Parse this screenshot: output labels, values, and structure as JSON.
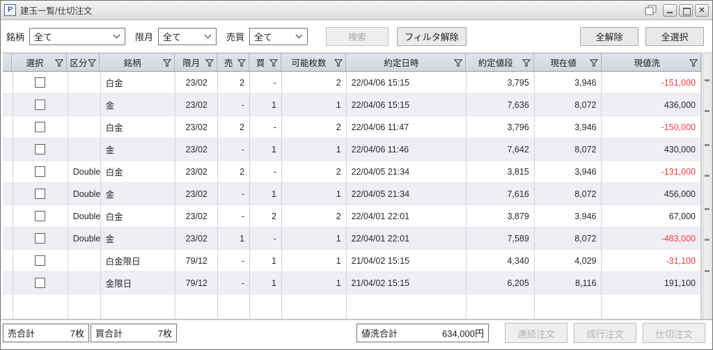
{
  "window": {
    "title": "建玉一覧/仕切注文",
    "icon_letter": "P"
  },
  "filters": {
    "symbol_label": "銘柄",
    "symbol_value": "全て",
    "month_label": "限月",
    "month_value": "全て",
    "side_label": "売買",
    "side_value": "全て",
    "search_button": "検索",
    "clear_filter_button": "フィルタ解除",
    "deselect_all_button": "全解除",
    "select_all_button": "全選択"
  },
  "table": {
    "columns": [
      "選択",
      "区分",
      "銘柄",
      "限月",
      "売",
      "買",
      "可能枚数",
      "約定日時",
      "約定値段",
      "現在値",
      "現値洗"
    ],
    "rows": [
      {
        "kubun": "",
        "name": "白金",
        "month": "23/02",
        "sell": "2",
        "buy": "-",
        "qty": "2",
        "time": "22/04/06 15:15",
        "price": "3,795",
        "now": "3,946",
        "pnl": "-151,000"
      },
      {
        "kubun": "",
        "name": "金",
        "month": "23/02",
        "sell": "-",
        "buy": "1",
        "qty": "1",
        "time": "22/04/06 15:15",
        "price": "7,636",
        "now": "8,072",
        "pnl": "436,000"
      },
      {
        "kubun": "",
        "name": "白金",
        "month": "23/02",
        "sell": "2",
        "buy": "-",
        "qty": "2",
        "time": "22/04/06 11:47",
        "price": "3,796",
        "now": "3,946",
        "pnl": "-150,000"
      },
      {
        "kubun": "",
        "name": "金",
        "month": "23/02",
        "sell": "-",
        "buy": "1",
        "qty": "1",
        "time": "22/04/06 11:46",
        "price": "7,642",
        "now": "8,072",
        "pnl": "430,000"
      },
      {
        "kubun": "Double",
        "name": "白金",
        "month": "23/02",
        "sell": "2",
        "buy": "-",
        "qty": "2",
        "time": "22/04/05 21:34",
        "price": "3,815",
        "now": "3,946",
        "pnl": "-131,000"
      },
      {
        "kubun": "Double",
        "name": "金",
        "month": "23/02",
        "sell": "-",
        "buy": "1",
        "qty": "1",
        "time": "22/04/05 21:34",
        "price": "7,616",
        "now": "8,072",
        "pnl": "456,000"
      },
      {
        "kubun": "Double",
        "name": "白金",
        "month": "23/02",
        "sell": "-",
        "buy": "2",
        "qty": "2",
        "time": "22/04/01 22:01",
        "price": "3,879",
        "now": "3,946",
        "pnl": "67,000"
      },
      {
        "kubun": "Double",
        "name": "金",
        "month": "23/02",
        "sell": "1",
        "buy": "-",
        "qty": "1",
        "time": "22/04/01 22:01",
        "price": "7,589",
        "now": "8,072",
        "pnl": "-483,000"
      },
      {
        "kubun": "",
        "name": "白金限日",
        "month": "79/12",
        "sell": "-",
        "buy": "1",
        "qty": "1",
        "time": "21/04/02 15:15",
        "price": "4,340",
        "now": "4,029",
        "pnl": "-31,100"
      },
      {
        "kubun": "",
        "name": "金限日",
        "month": "79/12",
        "sell": "-",
        "buy": "1",
        "qty": "1",
        "time": "21/04/02 15:15",
        "price": "6,205",
        "now": "8,116",
        "pnl": "191,100"
      }
    ]
  },
  "footer": {
    "sell_total_label": "売合計",
    "sell_total_value": "7枚",
    "buy_total_label": "買合計",
    "buy_total_value": "7枚",
    "pnl_total_label": "値洗合計",
    "pnl_total_value": "634,000円",
    "continuous_order_button": "連続注文",
    "market_order_button": "成行注文",
    "close_order_button": "仕切注文"
  },
  "colors": {
    "negative_value": "#ff3b3b",
    "header_bg": "#d7dbe4",
    "alt_row_bg": "#edeff4"
  }
}
